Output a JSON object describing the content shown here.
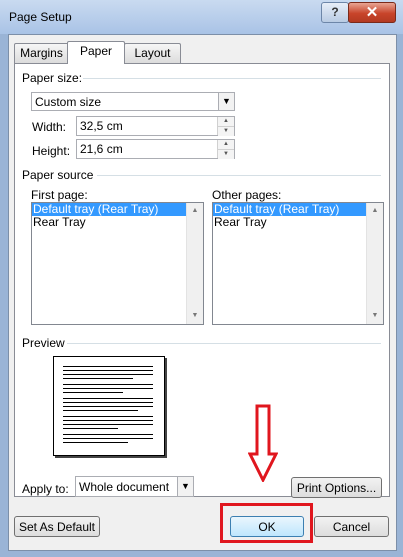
{
  "window": {
    "title": "Page Setup",
    "help_label": "?",
    "close_label": "✕"
  },
  "tabs": [
    {
      "label": "Margins"
    },
    {
      "label": "Paper"
    },
    {
      "label": "Layout"
    }
  ],
  "paper_size": {
    "group_label": "Paper size:",
    "selected": "Custom size",
    "width_label": "Width:",
    "width_value": "32,5 cm",
    "height_label": "Height:",
    "height_value": "21,6 cm"
  },
  "paper_source": {
    "group_label": "Paper source",
    "first_page_label": "First page:",
    "first_page_items": [
      "Default tray (Rear Tray)",
      "Rear Tray"
    ],
    "other_pages_label": "Other pages:",
    "other_pages_items": [
      "Default tray (Rear Tray)",
      "Rear Tray"
    ]
  },
  "preview": {
    "group_label": "Preview"
  },
  "apply_to": {
    "label": "Apply to:",
    "selected": "Whole document"
  },
  "buttons": {
    "print_options": "Print Options...",
    "set_as_default": "Set As Default",
    "ok": "OK",
    "cancel": "Cancel"
  },
  "annotation": {
    "arrow_color": "#e0161e",
    "highlight_color": "#e0161e"
  }
}
